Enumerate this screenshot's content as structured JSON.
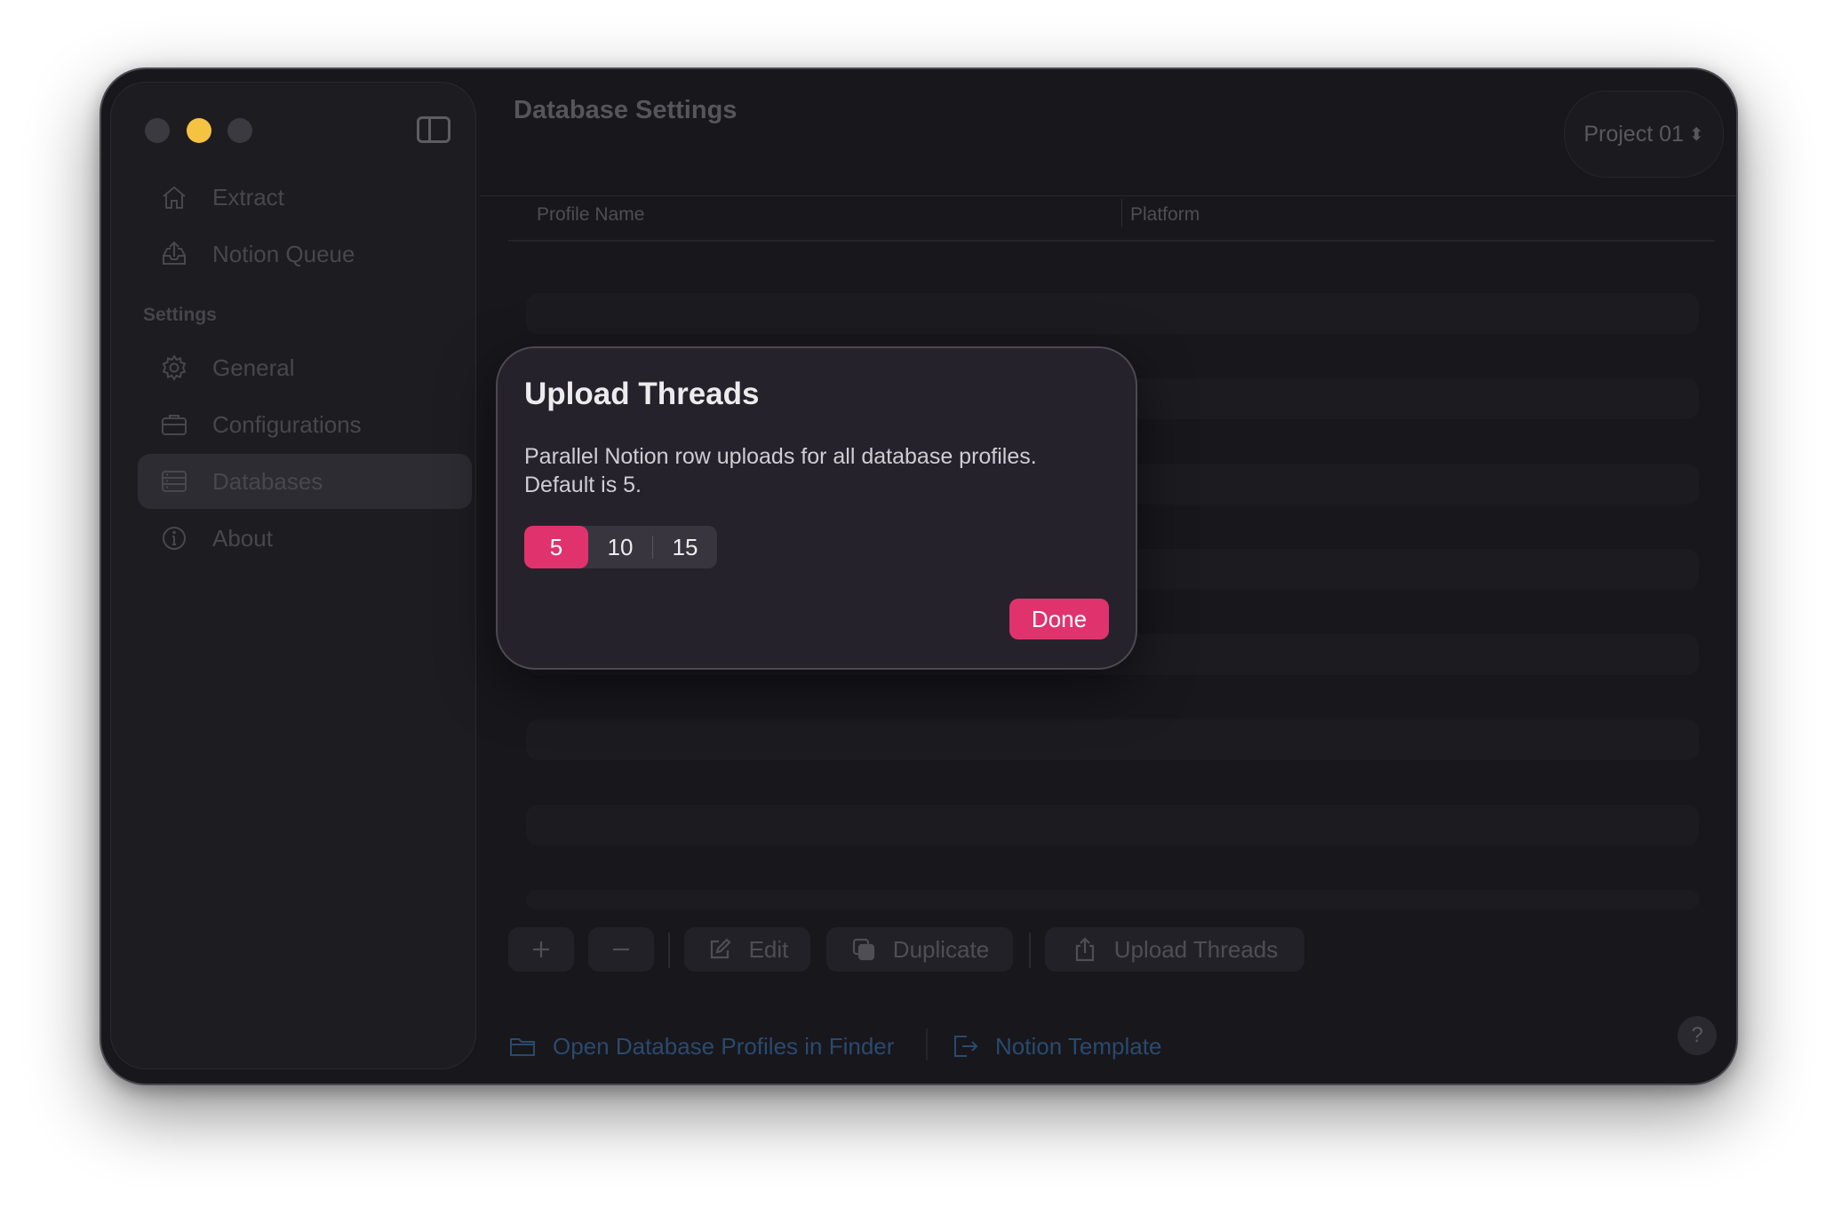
{
  "window": {
    "title": "Database Settings",
    "project_selector": "Project 01"
  },
  "sidebar": {
    "top_items": [
      {
        "label": "Extract",
        "icon": "house-icon"
      },
      {
        "label": "Notion Queue",
        "icon": "tray-upload-icon"
      }
    ],
    "section_label": "Settings",
    "settings_items": [
      {
        "label": "General",
        "icon": "gear-icon"
      },
      {
        "label": "Configurations",
        "icon": "briefcase-icon"
      },
      {
        "label": "Databases",
        "icon": "database-icon",
        "active": true
      },
      {
        "label": "About",
        "icon": "info-icon"
      }
    ]
  },
  "table": {
    "columns": [
      "Profile Name",
      "Platform"
    ]
  },
  "toolbar": {
    "add_icon": "plus-icon",
    "remove_icon": "minus-icon",
    "edit_label": "Edit",
    "duplicate_label": "Duplicate",
    "upload_threads_label": "Upload Threads"
  },
  "footer": {
    "open_finder_label": "Open Database Profiles in Finder",
    "notion_template_label": "Notion Template",
    "help_label": "?"
  },
  "modal": {
    "title": "Upload Threads",
    "description": "Parallel Notion row uploads for all database profiles. Default is 5.",
    "options": [
      "5",
      "10",
      "15"
    ],
    "selected": "5",
    "done_label": "Done"
  },
  "colors": {
    "accent": "#e0336e",
    "window_bg": "#18171c",
    "traffic_yellow": "#f5c342"
  }
}
